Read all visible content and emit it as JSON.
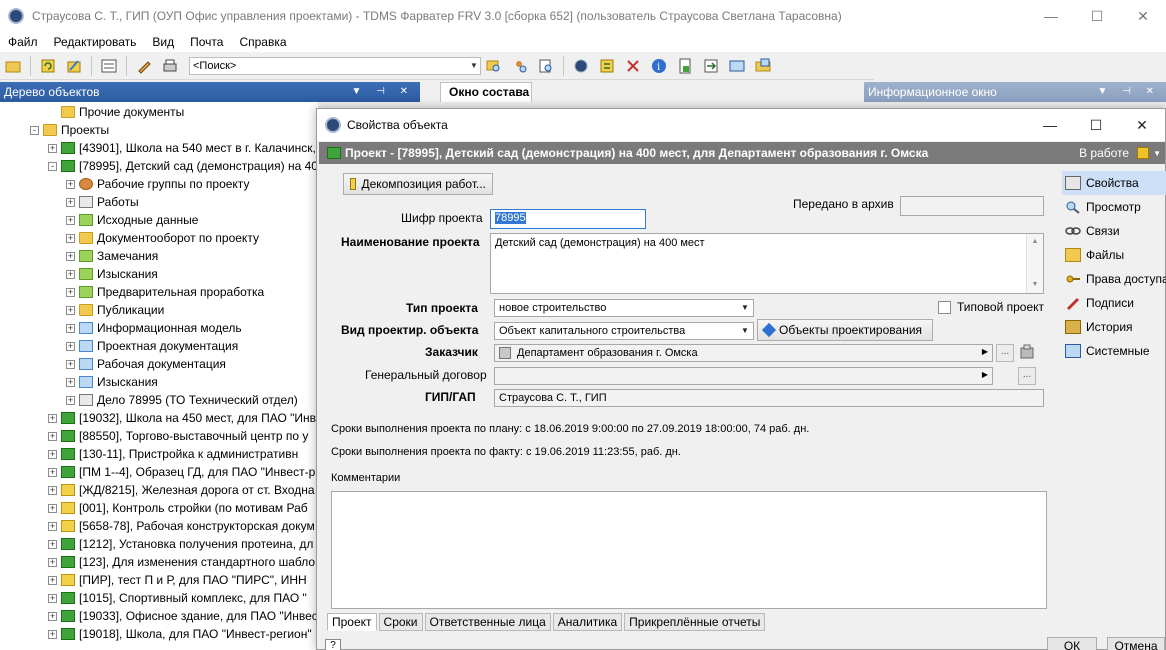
{
  "window": {
    "title": "Страусова С. Т., ГИП (ОУП Офис управления проектами) - TDMS Фарватер FRV 3.0 [сборка 652] (пользователь Страусова Светлана Тарасовна)",
    "minimize": "—",
    "maximize": "☐",
    "close": "✕"
  },
  "menu": [
    "Файл",
    "Редактировать",
    "Вид",
    "Почта",
    "Справка"
  ],
  "toolbar": {
    "search_placeholder": "<Поиск>"
  },
  "panels": {
    "tree_title": "Дерево объектов",
    "info_title": "Информационное окно",
    "composition_tab": "Окно состава"
  },
  "tree": [
    {
      "label": "Прочие документы",
      "expander": "",
      "icon": "folder",
      "level": 3
    },
    {
      "label": "Проекты",
      "expander": "-",
      "icon": "folder-projects",
      "level": 2
    },
    {
      "label": "[43901], Школа на 540 мест в г. Калачинск,",
      "expander": "+",
      "icon": "book-green",
      "level": 3
    },
    {
      "label": "[78995], Детский сад (демонстрация) на 40",
      "expander": "-",
      "icon": "book-green",
      "level": 3
    },
    {
      "label": "Рабочие группы по проекту",
      "expander": "+",
      "icon": "people",
      "level": 4
    },
    {
      "label": "Работы",
      "expander": "+",
      "icon": "doc",
      "level": 4
    },
    {
      "label": "Исходные данные",
      "expander": "+",
      "icon": "folder-green",
      "level": 4
    },
    {
      "label": "Документооборот по проекту",
      "expander": "+",
      "icon": "folder",
      "level": 4
    },
    {
      "label": "Замечания",
      "expander": "+",
      "icon": "folder-green",
      "level": 4
    },
    {
      "label": "Изыскания",
      "expander": "+",
      "icon": "folder-green",
      "level": 4
    },
    {
      "label": "Предварительная проработка",
      "expander": "+",
      "icon": "folder-green",
      "level": 4
    },
    {
      "label": "Публикации",
      "expander": "+",
      "icon": "folder",
      "level": 4
    },
    {
      "label": "Информационная модель",
      "expander": "+",
      "icon": "blue",
      "level": 4
    },
    {
      "label": "Проектная документация",
      "expander": "+",
      "icon": "blue",
      "level": 4
    },
    {
      "label": "Рабочая документация",
      "expander": "+",
      "icon": "blue",
      "level": 4
    },
    {
      "label": "Изыскания",
      "expander": "+",
      "icon": "blue",
      "level": 4
    },
    {
      "label": "Дело  78995 (ТО Технический отдел)",
      "expander": "+",
      "icon": "doc",
      "level": 4
    },
    {
      "label": "[19032], Школа на 450 мест, для ПАО \"Инв",
      "expander": "+",
      "icon": "book-green",
      "level": 3
    },
    {
      "label": "[88550], Торгово-выставочный центр по у",
      "expander": "+",
      "icon": "book-green",
      "level": 3
    },
    {
      "label": "[130-11], Пристройка к административн",
      "expander": "+",
      "icon": "book-green",
      "level": 3
    },
    {
      "label": "[ПМ 1--4], Образец ГД, для ПАО \"Инвест-р",
      "expander": "+",
      "icon": "book-green",
      "level": 3
    },
    {
      "label": "[ЖД/8215], Железная дорога от ст. Входна",
      "expander": "+",
      "icon": "book-yellow",
      "level": 3
    },
    {
      "label": "[001], Контроль стройки (по мотивам Раб",
      "expander": "+",
      "icon": "book-yellow",
      "level": 3
    },
    {
      "label": "[5658-78], Рабочая конструкторская докум",
      "expander": "+",
      "icon": "book-yellow",
      "level": 3
    },
    {
      "label": "[1212], Установка получения протеина, дл",
      "expander": "+",
      "icon": "book-green",
      "level": 3
    },
    {
      "label": "[123], Для изменения стандартного шабло",
      "expander": "+",
      "icon": "book-green",
      "level": 3
    },
    {
      "label": "[ПИР], тест П и Р, для ПАО \"ПИРС\", ИНН",
      "expander": "+",
      "icon": "book-yellow",
      "level": 3
    },
    {
      "label": "[1015], Спортивный комплекс, для ПАО \"",
      "expander": "+",
      "icon": "book-green",
      "level": 3
    },
    {
      "label": "[19033], Офисное здание, для ПАО \"Инвес",
      "expander": "+",
      "icon": "book-green",
      "level": 3
    },
    {
      "label": "[19018], Школа, для ПАО \"Инвест-регион\"",
      "expander": "+",
      "icon": "book-green",
      "level": 3
    }
  ],
  "dialog": {
    "title": "Свойства объекта",
    "object_header": "Проект - [78995], Детский сад (демонстрация) на 400 мест, для Департамент образования г. Омска",
    "status": "В работе",
    "decomposition_button": "Декомпозиция работ...",
    "archived_label": "Передано в архив",
    "archived_value": "",
    "code_label": "Шифр проекта",
    "code_value": "78995",
    "name_label": "Наименование проекта",
    "name_value": "Детский сад (демонстрация) на 400 мест",
    "type_label": "Тип проекта",
    "type_value": "новое строительство",
    "typical_label": "Типовой проект",
    "object_kind_label": "Вид проектир. объекта",
    "object_kind_value": "Объект капитального строительства",
    "design_objects_button": "Объекты проектирования",
    "customer_label": "Заказчик",
    "customer_value": "Департамент образования г. Омска",
    "contract_label": "Генеральный договор",
    "contract_value": "",
    "chief_label": "ГИП/ГАП",
    "chief_value": "Страусова С. Т., ГИП",
    "plan_terms": "Сроки выполнения проекта по плану: с 18.06.2019 9:00:00 по 27.09.2019 18:00:00, 74 раб. дн.",
    "fact_terms": "Сроки выполнения проекта по факту: с 19.06.2019 11:23:55,  раб. дн.",
    "comments_label": "Комментарии",
    "comments_value": "",
    "ellipsis": "...",
    "nav": [
      "Свойства",
      "Просмотр",
      "Связи",
      "Файлы",
      "Права доступа",
      "Подписи",
      "История",
      "Системные"
    ],
    "tabs": [
      "Проект",
      "Сроки",
      "Ответственные лица",
      "Аналитика",
      "Прикреплённые отчеты"
    ],
    "help": "?",
    "ok": "ОК",
    "cancel": "Отмена"
  }
}
